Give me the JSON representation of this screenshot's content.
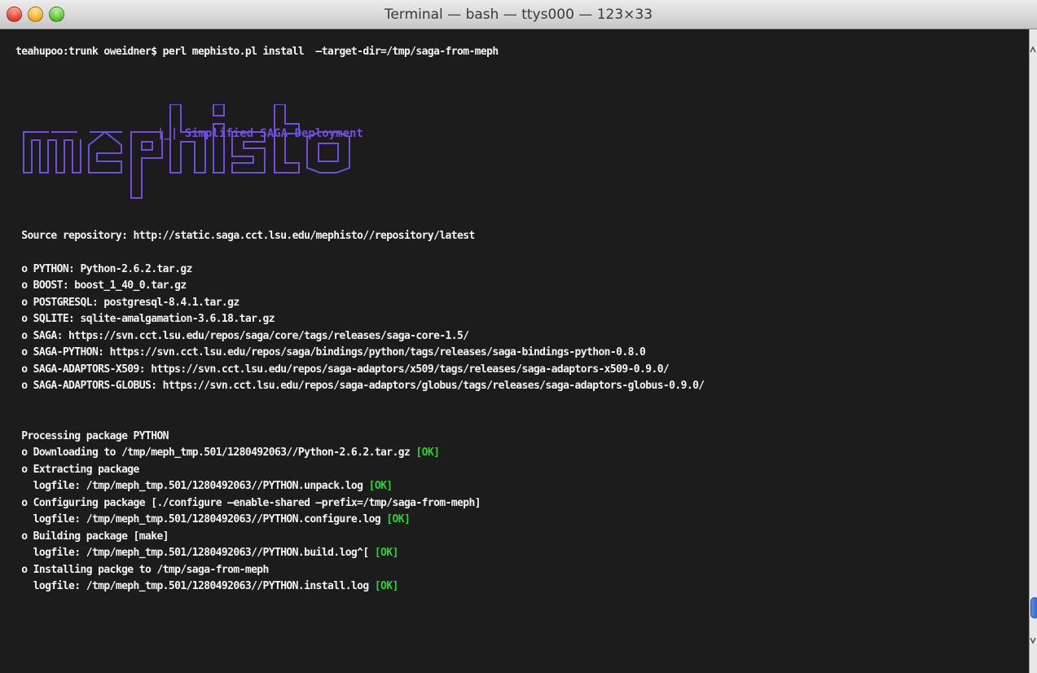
{
  "window": {
    "title": "Terminal — bash — ttys000 — 123×33"
  },
  "terminal": {
    "prompt_line": "teahupoo:trunk oweidner$ perl mephisto.pl install  —target-dir=/tmp/saga-from-meph",
    "logo_text": "mephisto",
    "banner": "Simplified SAGA Deployment",
    "source_repo": " Source repository: http://static.saga.cct.lsu.edu/mephisto//repository/latest",
    "packages": [
      " o PYTHON: Python-2.6.2.tar.gz",
      " o BOOST: boost_1_40_0.tar.gz",
      " o POSTGRESQL: postgresql-8.4.1.tar.gz",
      " o SQLITE: sqlite-amalgamation-3.6.18.tar.gz",
      " o SAGA: https://svn.cct.lsu.edu/repos/saga/core/tags/releases/saga-core-1.5/",
      " o SAGA-PYTHON: https://svn.cct.lsu.edu/repos/saga/bindings/python/tags/releases/saga-bindings-python-0.8.0",
      " o SAGA-ADAPTORS-X509: https://svn.cct.lsu.edu/repos/saga-adaptors/x509/tags/releases/saga-adaptors-x509-0.9.0/",
      " o SAGA-ADAPTORS-GLOBUS: https://svn.cct.lsu.edu/repos/saga-adaptors/globus/tags/releases/saga-adaptors-globus-0.9.0/"
    ],
    "processing_header": " Processing package PYTHON",
    "steps": {
      "download": " o Downloading to /tmp/meph_tmp.501/1280492063//Python-2.6.2.tar.gz ",
      "extract": " o Extracting package",
      "extract_log": "   logfile: /tmp/meph_tmp.501/1280492063//PYTHON.unpack.log ",
      "configure": " o Configuring package [./configure —enable-shared —prefix=/tmp/saga-from-meph]",
      "configure_log": "   logfile: /tmp/meph_tmp.501/1280492063//PYTHON.configure.log ",
      "build": " o Building package [make]",
      "build_log": "   logfile: /tmp/meph_tmp.501/1280492063//PYTHON.build.log^[ ",
      "install": " o Installing packge to /tmp/saga-from-meph",
      "install_log": "   logfile: /tmp/meph_tmp.501/1280492063//PYTHON.install.log "
    },
    "ok_label": "[OK]"
  },
  "colors": {
    "ok": "#2fd02f",
    "logo": "#6f4fe0",
    "background": "#1c1c1c",
    "text": "#f4f4f4"
  },
  "icons": [
    "close-button",
    "minimize-button",
    "zoom-button",
    "scroll-up-arrow",
    "scroll-down-arrow"
  ]
}
